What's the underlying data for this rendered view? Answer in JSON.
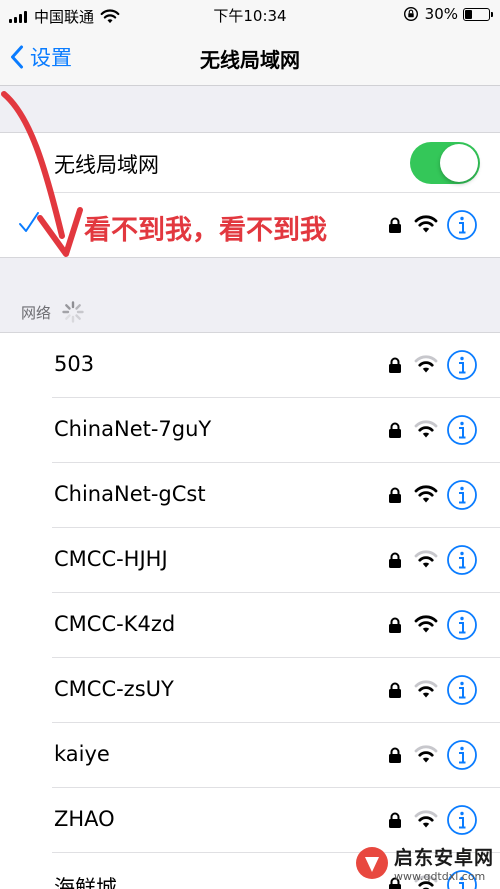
{
  "status_bar": {
    "carrier": "中国联通",
    "time": "下午10:34",
    "battery_percent": "30%",
    "battery_level": 0.3
  },
  "nav": {
    "back_label": "设置",
    "title": "无线局域网"
  },
  "wifi_toggle": {
    "label": "无线局域网",
    "on": true
  },
  "connected_network": {
    "name": "看不到我，看不到我",
    "secured": true,
    "signal_bars": 3
  },
  "annotation": {
    "text": "看不到我，看不到我",
    "color": "#e2383f"
  },
  "networks_section": {
    "header": "网络"
  },
  "networks": [
    {
      "name": "503",
      "secured": true,
      "signal_bars": 2
    },
    {
      "name": "ChinaNet-7guY",
      "secured": true,
      "signal_bars": 2
    },
    {
      "name": "ChinaNet-gCst",
      "secured": true,
      "signal_bars": 3
    },
    {
      "name": "CMCC-HJHJ",
      "secured": true,
      "signal_bars": 2
    },
    {
      "name": "CMCC-K4zd",
      "secured": true,
      "signal_bars": 3
    },
    {
      "name": "CMCC-zsUY",
      "secured": true,
      "signal_bars": 2
    },
    {
      "name": "kaiye",
      "secured": true,
      "signal_bars": 2
    },
    {
      "name": "ZHAO",
      "secured": true,
      "signal_bars": 2
    },
    {
      "name": "海鲜城",
      "secured": true,
      "signal_bars": 2
    }
  ],
  "watermark": {
    "title": "启东安卓网",
    "url": "www.qdtdxl.com"
  },
  "colors": {
    "accent": "#0a7cff",
    "toggle_on": "#34c759",
    "annotation": "#e2383f"
  }
}
